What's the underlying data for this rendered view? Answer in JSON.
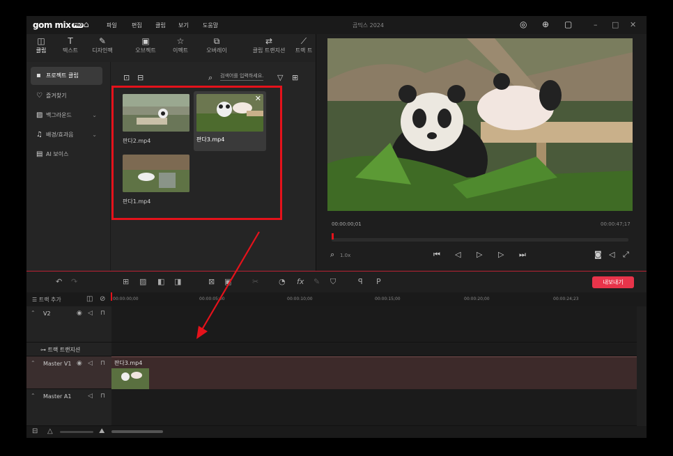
{
  "app": {
    "logo": "gom mix",
    "logo_badge": "PRO",
    "title": "곰믹스 2024",
    "menu": [
      "파일",
      "편집",
      "클립",
      "보기",
      "도움말"
    ]
  },
  "tabs": [
    {
      "label": "클립",
      "icon": "clip-icon",
      "active": true
    },
    {
      "label": "텍스트",
      "icon": "text-icon"
    },
    {
      "label": "디자인팩",
      "icon": "design-icon"
    },
    {
      "label": "오브젝트",
      "icon": "object-icon"
    },
    {
      "label": "이펙트",
      "icon": "effect-icon"
    },
    {
      "label": "오버레이",
      "icon": "overlay-icon"
    },
    {
      "label": "클립 트랜지션",
      "icon": "transition-icon"
    },
    {
      "label": "트랙 트",
      "icon": "track-icon"
    }
  ],
  "sidebar": [
    {
      "label": "프로젝트 클립",
      "icon": "folder-icon",
      "selected": true
    },
    {
      "label": "즐겨찾기",
      "icon": "heart-icon"
    },
    {
      "label": "백그라운드",
      "icon": "background-icon",
      "chevron": true
    },
    {
      "label": "배경/효과음",
      "icon": "music-icon",
      "chevron": true
    },
    {
      "label": "AI 보이스",
      "icon": "ai-voice-icon"
    }
  ],
  "media": {
    "search_placeholder": "검색어를 입력하세요.",
    "clips": [
      {
        "name": "판다2.mp4"
      },
      {
        "name": "판다3.mp4",
        "selected": true
      },
      {
        "name": "판다1.mp4"
      }
    ]
  },
  "preview": {
    "current_time": "00:00:00;01",
    "total_time": "00:00:47;17",
    "zoom": "1.0x"
  },
  "timeline": {
    "export_label": "내보내기",
    "add_track_label": "트랙 추가",
    "ruler": [
      "00:00:00;00",
      "00:00:05;00",
      "00:00:10;00",
      "00:00:15;00",
      "00:00:20;00",
      "00:00:24;23"
    ],
    "tracks": [
      {
        "name": "V2"
      },
      {
        "name": "트랙 트랜지션"
      },
      {
        "name": "Master V1"
      },
      {
        "name": "Master A1"
      }
    ],
    "clip_on_master": "판다3.mp4"
  },
  "colors": {
    "accent_red": "#e5121b",
    "export_btn": "#e8344a"
  }
}
